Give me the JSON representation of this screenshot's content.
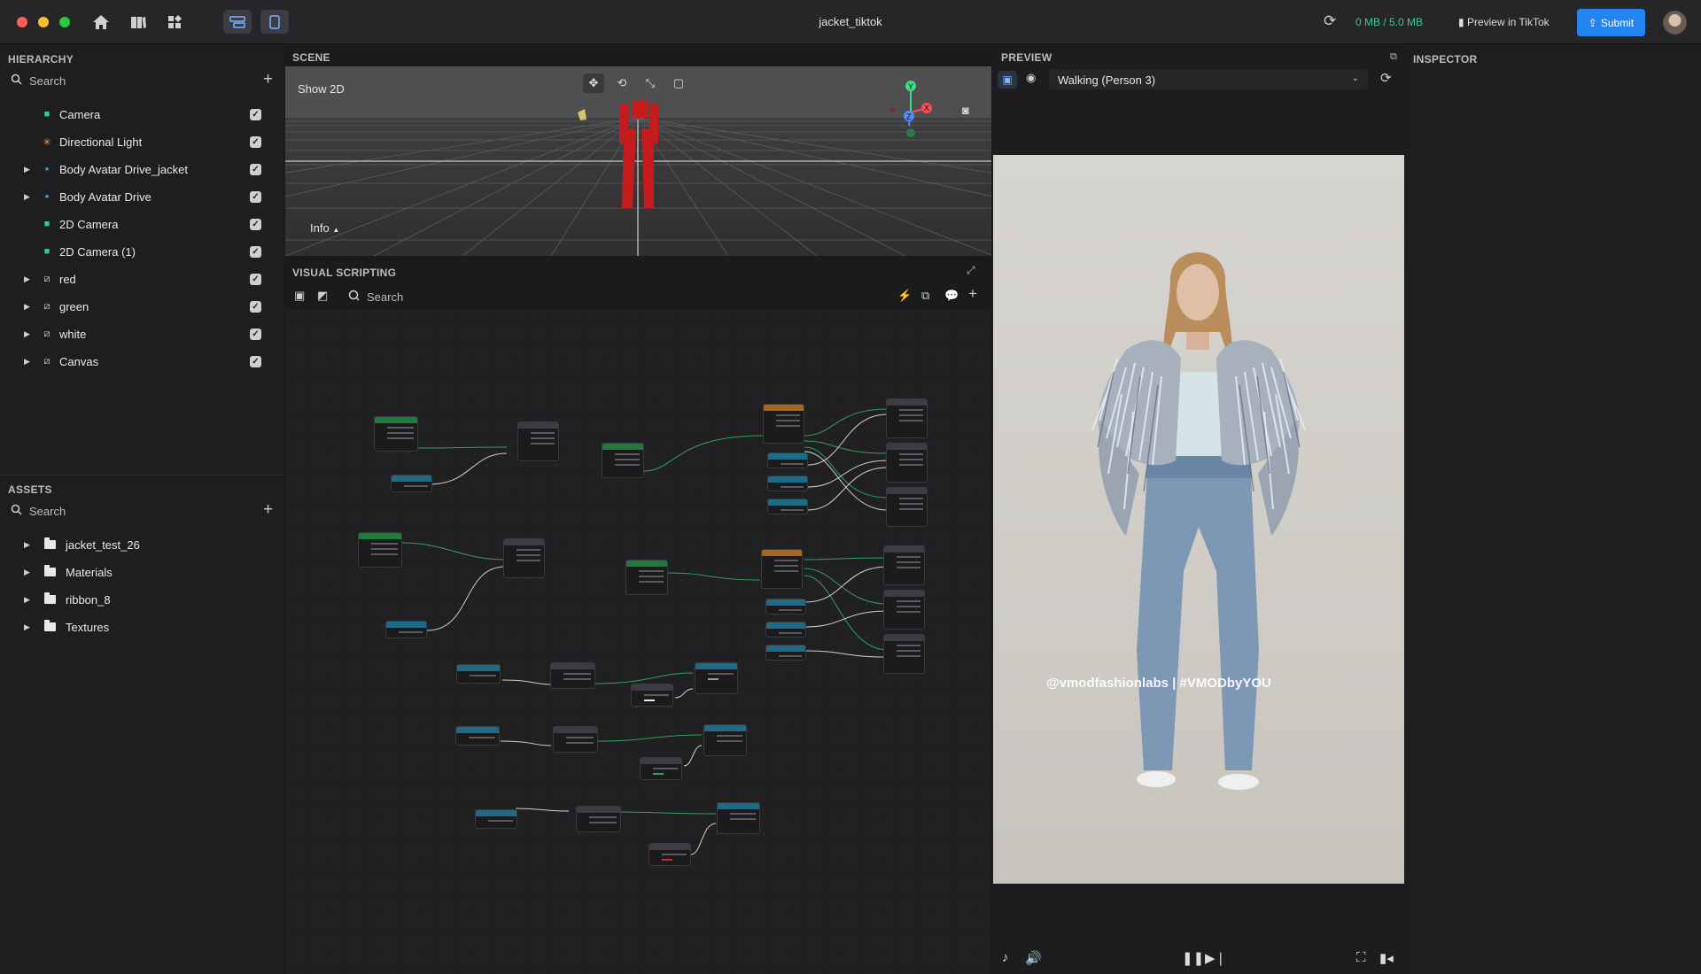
{
  "app": {
    "window_title": "jacket_tiktok",
    "memory": "0 MB / 5.0 MB",
    "preview_tiktok": "Preview in TikTok",
    "submit": "Submit"
  },
  "hierarchy": {
    "title": "HIERARCHY",
    "search": "Search",
    "items": [
      {
        "label": "Camera"
      },
      {
        "label": "Directional Light"
      },
      {
        "label": "Body Avatar Drive_jacket"
      },
      {
        "label": "Body Avatar Drive"
      },
      {
        "label": "2D Camera"
      },
      {
        "label": "2D Camera (1)"
      },
      {
        "label": "red"
      },
      {
        "label": "green"
      },
      {
        "label": "white"
      },
      {
        "label": "Canvas"
      }
    ]
  },
  "assets": {
    "title": "ASSETS",
    "search": "Search",
    "items": [
      {
        "label": "jacket_test_26"
      },
      {
        "label": "Materials"
      },
      {
        "label": "ribbon_8"
      },
      {
        "label": "Textures"
      }
    ]
  },
  "scene": {
    "title": "SCENE",
    "show2d": "Show 2D",
    "info": "Info",
    "axis_y": "Y",
    "axis_z": "Z",
    "axis_x": "X"
  },
  "visual_scripting": {
    "title": "VISUAL SCRIPTING",
    "search": "Search"
  },
  "preview": {
    "title": "PREVIEW",
    "animation": "Walking (Person 3)",
    "watermark": "@vmodfashionlabs  |  #VMODbyYOU"
  },
  "inspector": {
    "title": "INSPECTOR"
  },
  "colors": {
    "accent": "#2485f0",
    "memory_green": "#2ecf8c",
    "camera_green": "#2ecf8c",
    "light_orange": "#f0a640",
    "avatar_teal": "#3fb7e8"
  }
}
